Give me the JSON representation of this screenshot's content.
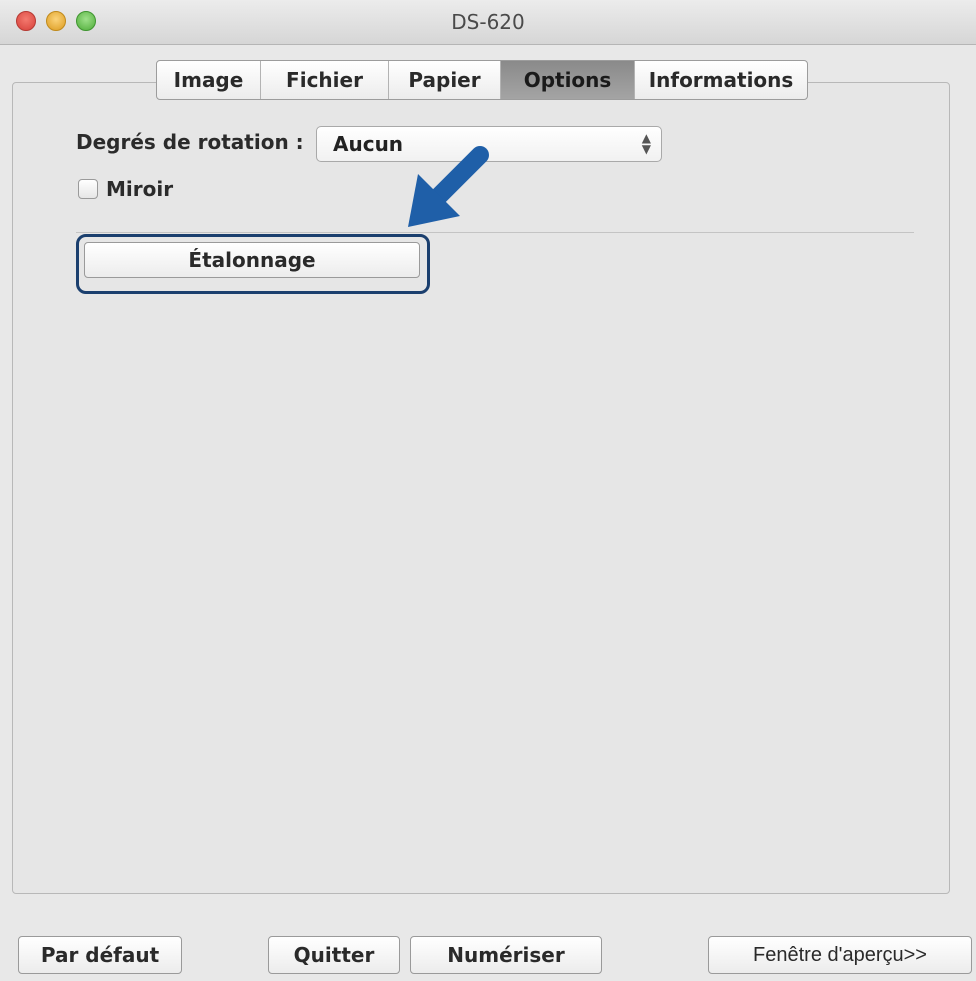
{
  "window": {
    "title": "DS-620"
  },
  "tabs": [
    {
      "label": "Image",
      "active": false
    },
    {
      "label": "Fichier",
      "active": false
    },
    {
      "label": "Papier",
      "active": false
    },
    {
      "label": "Options",
      "active": true
    },
    {
      "label": "Informations",
      "active": false
    }
  ],
  "options": {
    "rotation_label": "Degrés de rotation :",
    "rotation_value": "Aucun",
    "mirror_label": "Miroir",
    "mirror_checked": false,
    "calibration_button": "Étalonnage"
  },
  "footer": {
    "default_button": "Par défaut",
    "quit_button": "Quitter",
    "scan_button": "Numériser",
    "preview_button": "Fenêtre d'aperçu>>"
  },
  "colors": {
    "callout_arrow": "#1f5fa8",
    "highlight_border": "#1b3f6e"
  }
}
